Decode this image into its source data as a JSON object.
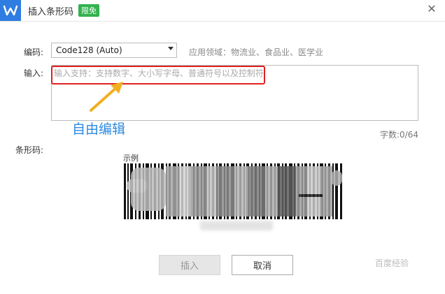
{
  "window": {
    "title": "插入条形码",
    "badge": "限免"
  },
  "form": {
    "encode_label": "编码:",
    "encode_value": "Code128 (Auto)",
    "encode_hint": "应用领域：物流业、食品业、医学业",
    "input_label": "输入:",
    "input_placeholder": "输入支持：支持数字、大小写字母、普通符号以及控制符",
    "char_count": "字数:0/64",
    "barcode_label": "条形码:",
    "example_label": "示例"
  },
  "annotation": {
    "text": "自由编辑",
    "color": "#2c8ae0",
    "box_color": "#e02020",
    "arrow_color": "#f0b021"
  },
  "buttons": {
    "insert": "插入",
    "cancel": "取消"
  },
  "watermark": "百度经验",
  "colors": {
    "logo": "#2f7de1",
    "badge": "#33b24e"
  }
}
